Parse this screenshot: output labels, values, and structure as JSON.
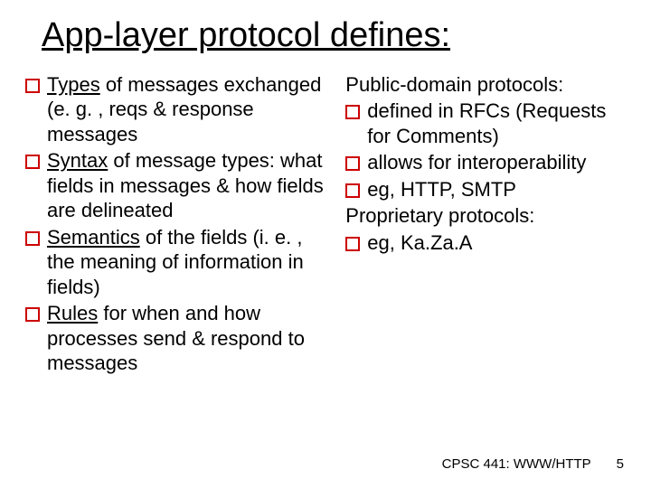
{
  "title": "App-layer protocol defines:",
  "left": {
    "items": [
      {
        "lead": "Types",
        "rest": " of messages exchanged (e. g. , reqs  & response messages"
      },
      {
        "lead": "Syntax",
        "rest": " of message types: what fields in messages & how fields are delineated"
      },
      {
        "lead": "Semantics",
        "rest": " of the fields (i. e. , the meaning of information in fields)"
      },
      {
        "lead": "Rules",
        "rest": " for when and how processes send & respond to messages"
      }
    ]
  },
  "right": {
    "heading1": "Public-domain protocols:",
    "items1": [
      {
        "text": "defined in RFCs (Requests for Comments)"
      },
      {
        "text": "allows for interoperability"
      },
      {
        "text": "eg, HTTP, SMTP"
      }
    ],
    "heading2": "Proprietary protocols:",
    "items2": [
      {
        "text": "eg, Ka.Za.A"
      }
    ]
  },
  "footer": {
    "course": "CPSC 441: WWW/HTTP",
    "page": "5"
  }
}
